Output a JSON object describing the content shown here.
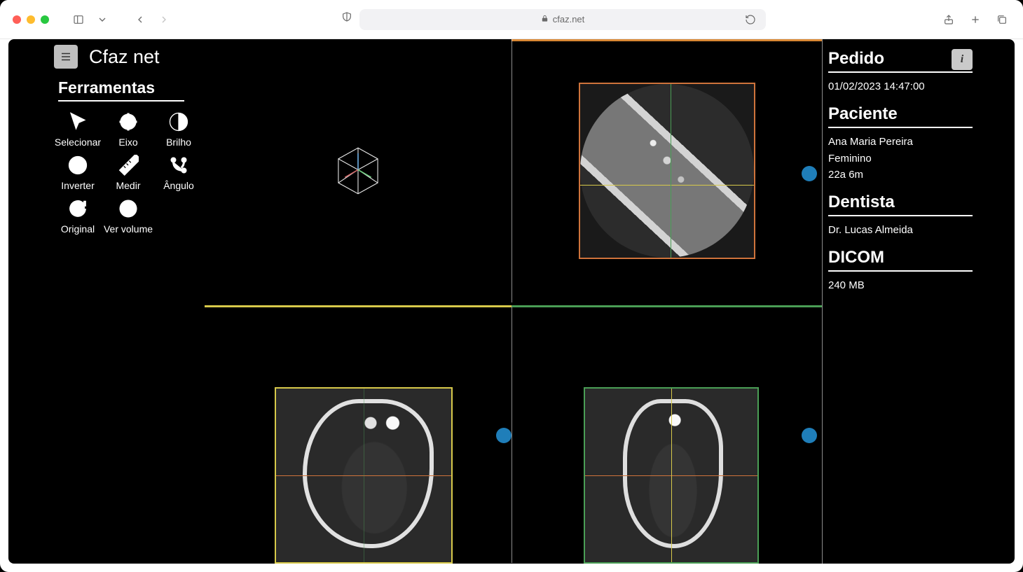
{
  "browser": {
    "url_text": "cfaz.net"
  },
  "app": {
    "title": "Cfaz net",
    "tools_header": "Ferramentas",
    "tools": {
      "select": {
        "label": "Selecionar"
      },
      "axis": {
        "label": "Eixo"
      },
      "bright": {
        "label": "Brilho"
      },
      "invert": {
        "label": "Inverter"
      },
      "measure": {
        "label": "Medir"
      },
      "angle": {
        "label": "Ângulo"
      },
      "original": {
        "label": "Original"
      },
      "volume": {
        "label": "Ver volume"
      }
    }
  },
  "info": {
    "pedido": {
      "header": "Pedido",
      "datetime": "01/02/2023 14:47:00"
    },
    "paciente": {
      "header": "Paciente",
      "name": "Ana Maria Pereira",
      "gender": "Feminino",
      "age": "22a 6m"
    },
    "dentista": {
      "header": "Dentista",
      "name": "Dr. Lucas Almeida"
    },
    "dicom": {
      "header": "DICOM",
      "size": "240 MB"
    }
  },
  "colors": {
    "axial_border": "#cf733b",
    "coronal_border": "#d7c94a",
    "sagittal_border": "#4a9e55",
    "handle": "#1f7eb9"
  }
}
